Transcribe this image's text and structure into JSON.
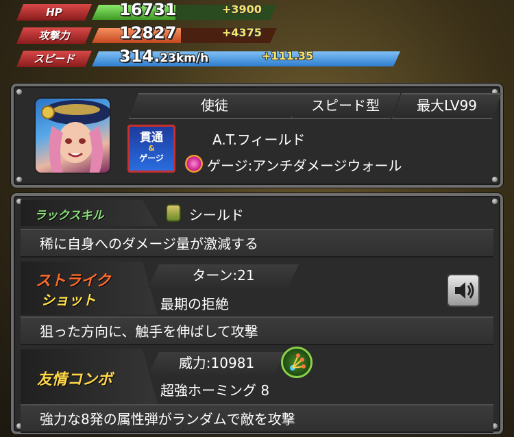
{
  "stats": [
    {
      "label": "HP",
      "value": "16731",
      "value_unit": "",
      "bonus": "+3900",
      "label_color": "#d84a4a",
      "bar_color": "#59c23a",
      "fill": 0.45
    },
    {
      "label": "攻撃力",
      "value": "12827",
      "value_unit": "",
      "bonus": "+4375",
      "label_color": "#d84a4a",
      "bar_color": "#e96a3a",
      "fill": 0.48
    },
    {
      "label": "スピード",
      "value": "314.",
      "value_unit": "23km/h",
      "bonus": "+111.35",
      "label_color": "#d84a4a",
      "bar_color": "#4a9be0",
      "fill": 1.0
    }
  ],
  "character": {
    "race": "使徒",
    "type": "スピード型",
    "max_level": "最大LV99",
    "ability": "A.T.フィールド",
    "gauge_ability": "ゲージ:アンチダメージウォール",
    "ability_icon_text": [
      "貫通",
      "&",
      "ゲージ"
    ]
  },
  "luck_skill": {
    "tag": "ラックスキル",
    "name": "シールド",
    "description": "稀に自身へのダメージ量が激減する"
  },
  "strike_shot": {
    "tag_line1": "ストライク",
    "tag_line2": "ショット",
    "turns": "ターン:21",
    "name": "最期の拒絶",
    "description": "狙った方向に、触手を伸ばして攻撃"
  },
  "friendship_combo": {
    "tag": "友情コンボ",
    "power": "威力:10981",
    "name": "超強ホーミング 8",
    "description": "強力な8発の属性弾がランダムで敵を攻撃"
  },
  "colors": {
    "panel_bg": "#2b2b2b",
    "luck_tag": "#8be07a",
    "strike_tag_top": "#ff5a2a",
    "strike_tag_bottom": "#ffe14a",
    "friend_tag": "#ffd84a"
  }
}
